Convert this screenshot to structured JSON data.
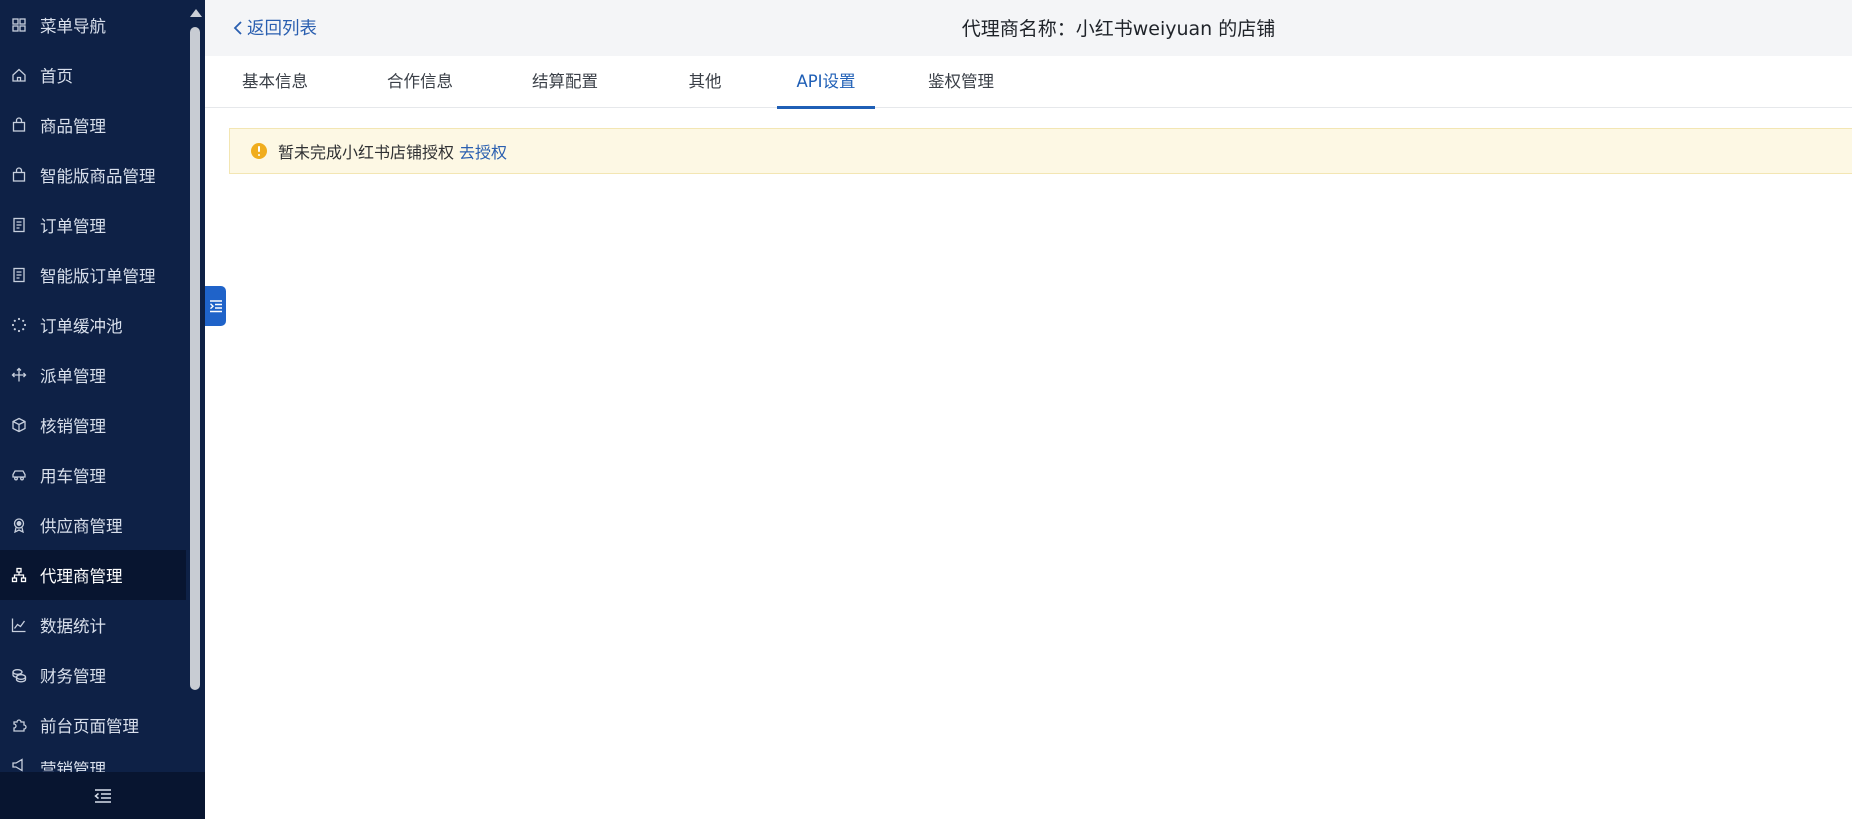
{
  "sidebar": {
    "items": [
      {
        "label": "菜单导航",
        "icon": "grid-icon"
      },
      {
        "label": "首页",
        "icon": "home-icon"
      },
      {
        "label": "商品管理",
        "icon": "bag-icon"
      },
      {
        "label": "智能版商品管理",
        "icon": "bag-icon"
      },
      {
        "label": "订单管理",
        "icon": "document-icon"
      },
      {
        "label": "智能版订单管理",
        "icon": "document-icon"
      },
      {
        "label": "订单缓冲池",
        "icon": "loading-icon"
      },
      {
        "label": "派单管理",
        "icon": "dispatch-icon"
      },
      {
        "label": "核销管理",
        "icon": "box-icon"
      },
      {
        "label": "用车管理",
        "icon": "car-icon"
      },
      {
        "label": "供应商管理",
        "icon": "badge-icon"
      },
      {
        "label": "代理商管理",
        "icon": "network-icon"
      },
      {
        "label": "数据统计",
        "icon": "chart-line-icon"
      },
      {
        "label": "财务管理",
        "icon": "coins-icon"
      },
      {
        "label": "前台页面管理",
        "icon": "puzzle-icon"
      },
      {
        "label": "营销管理",
        "icon": "marketing-icon"
      }
    ],
    "active_label": "代理商管理"
  },
  "header": {
    "back_label": "返回列表",
    "title": "代理商名称：小红书weiyuan 的店铺"
  },
  "tabs": [
    {
      "label": "基本信息"
    },
    {
      "label": "合作信息"
    },
    {
      "label": "结算配置"
    },
    {
      "label": "其他"
    },
    {
      "label": "API设置"
    },
    {
      "label": "鉴权管理"
    }
  ],
  "active_tab": "API设置",
  "alert": {
    "message": "暂未完成小红书店铺授权",
    "link_label": "去授权"
  },
  "colors": {
    "sidebar_bg": "#0e2146",
    "sidebar_active_bg": "#081530",
    "accent": "#1f5fb6",
    "alert_bg": "#fdf8e4",
    "warning": "#f0ad1e"
  }
}
